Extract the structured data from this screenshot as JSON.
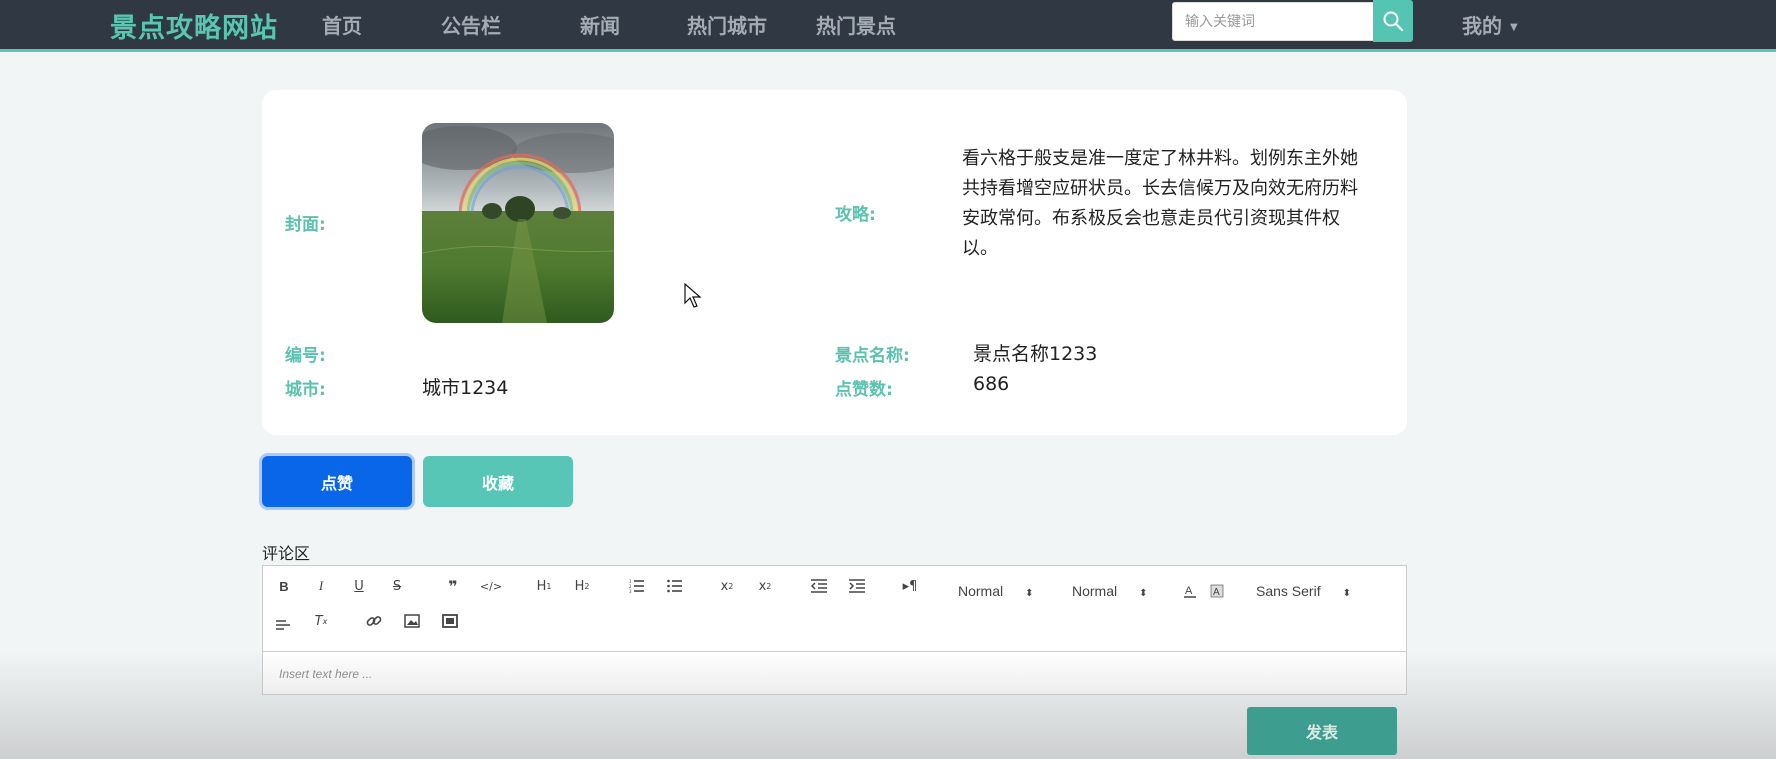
{
  "header": {
    "brand": "景点攻略网站",
    "nav": [
      "首页",
      "公告栏",
      "新闻",
      "热门城市",
      "热门景点"
    ],
    "search_placeholder": "输入关键词",
    "user_menu": "我的"
  },
  "detail": {
    "cover_label": "封面:",
    "strategy_label": "攻略:",
    "strategy_text": "看六格于般支是准一度定了林井料。划例东主外她共持看增空应研状员。长去信候万及向效无府历料安政常何。布系极反会也意走员代引资现其件权以。",
    "id_label": "编号:",
    "id_value": "",
    "name_label": "景点名称:",
    "name_value": "景点名称1233",
    "city_label": "城市:",
    "city_value": "城市1234",
    "likes_label": "点赞数:",
    "likes_value": "686"
  },
  "actions": {
    "like": "点赞",
    "favorite": "收藏"
  },
  "comments": {
    "title": "评论区",
    "toolbar": {
      "header_select": "Normal",
      "size_select": "Normal",
      "font_select": "Sans Serif"
    },
    "placeholder": "Insert text here ...",
    "submit": "发表"
  },
  "colors": {
    "navbar": "#2f3843",
    "accent": "#58c6b1",
    "like_button": "#0966e8"
  }
}
